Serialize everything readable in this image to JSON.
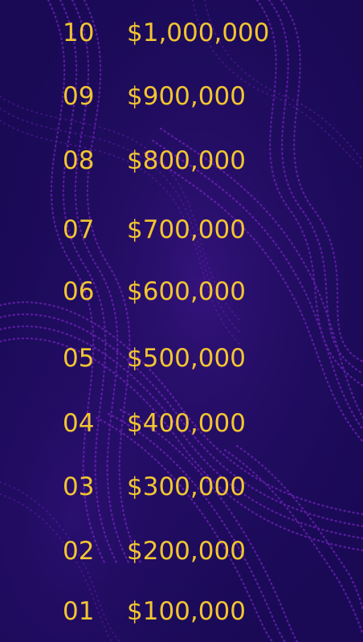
{
  "colors": {
    "background": "#1b0b5a",
    "text": "#f2c531",
    "wave_accent": "#8a2bd8"
  },
  "ladder": [
    {
      "level": "10",
      "amount": "$1,000,000"
    },
    {
      "level": "09",
      "amount": "$900,000"
    },
    {
      "level": "08",
      "amount": "$800,000"
    },
    {
      "level": "07",
      "amount": "$700,000"
    },
    {
      "level": "06",
      "amount": "$600,000"
    },
    {
      "level": "05",
      "amount": "$500,000"
    },
    {
      "level": "04",
      "amount": "$400,000"
    },
    {
      "level": "03",
      "amount": "$300,000"
    },
    {
      "level": "02",
      "amount": "$200,000"
    },
    {
      "level": "01",
      "amount": "$100,000"
    }
  ]
}
